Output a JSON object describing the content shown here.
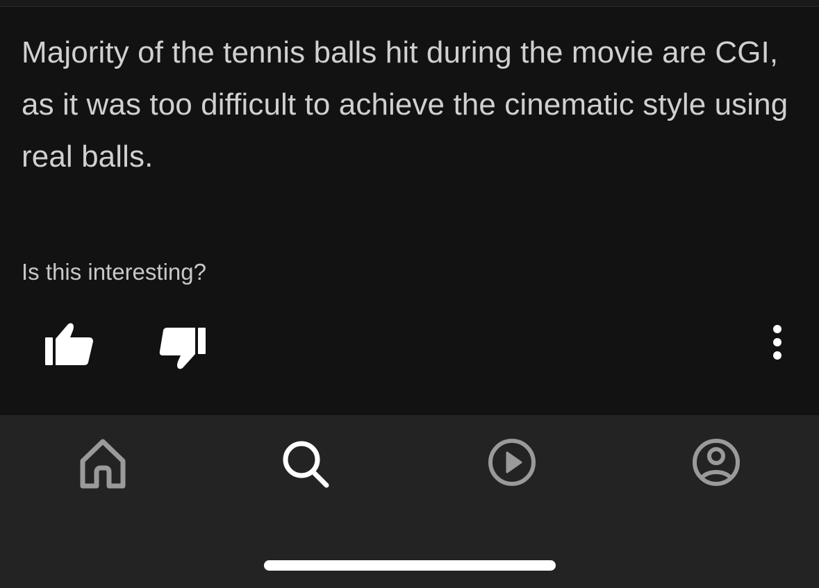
{
  "fact": {
    "text": "Majority of the tennis balls hit during the movie are CGI, as it was too difficult to achieve the cinematic style using real balls."
  },
  "feedback": {
    "prompt": "Is this interesting?",
    "thumbs_up_icon": "thumbs-up-icon",
    "thumbs_down_icon": "thumbs-down-icon",
    "more_icon": "more-vertical-icon"
  },
  "tab_bar": {
    "tabs": [
      {
        "icon": "home-icon",
        "active": false
      },
      {
        "icon": "search-icon",
        "active": true
      },
      {
        "icon": "play-icon",
        "active": false
      },
      {
        "icon": "profile-icon",
        "active": false
      }
    ]
  },
  "colors": {
    "background": "#121212",
    "tab_bar_background": "#232323",
    "text_primary": "#d0d0d0",
    "icon_active": "#ffffff",
    "icon_inactive": "#9a9a9a"
  }
}
